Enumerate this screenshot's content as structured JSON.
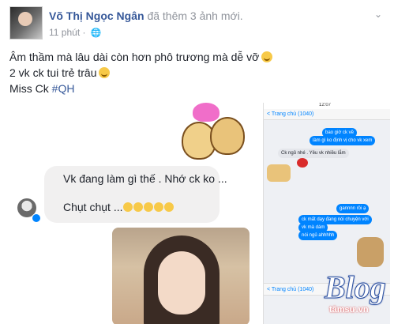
{
  "post": {
    "author": "Võ Thị Ngọc Ngân",
    "action": "đã thêm 3 ảnh mới.",
    "time": "11 phút",
    "separator": "·",
    "caption_line1": "Âm thầm mà lâu dài còn hơn phô trương mà dễ vỡ",
    "caption_line2": "2 vk ck tui trẻ trâu",
    "caption_line3_prefix": "Miss Ck ",
    "caption_line3_hashtag": "#QH"
  },
  "photo1": {
    "message1": "Vk đang làm gì thế . Nhớ ck ko ...",
    "message2": "Chụt chụt ..."
  },
  "photo2": {
    "time": "12:07",
    "header": "< Trang chủ (1040)",
    "bubbles": [
      "bao giờ ck về",
      "làm gì ko định vị cho vk xem",
      "Ck ngủ nhé . Yêu vk nhiều lắm",
      "gannnn rồi ạ",
      "ck mất dạy đang nói chuyện với",
      "vk mà dám",
      "nói ngủ ahhhhh"
    ],
    "header2": "< Trang chủ (1040)"
  },
  "watermark": {
    "logo": "Blog",
    "site": "tâmsư.vn"
  },
  "icons": {
    "globe": "globe-icon",
    "chevron": "chevron-down-icon",
    "messenger": "messenger-badge-icon"
  },
  "colors": {
    "author_link": "#365899",
    "meta_text": "#90949c",
    "messenger_blue": "#0084ff"
  }
}
